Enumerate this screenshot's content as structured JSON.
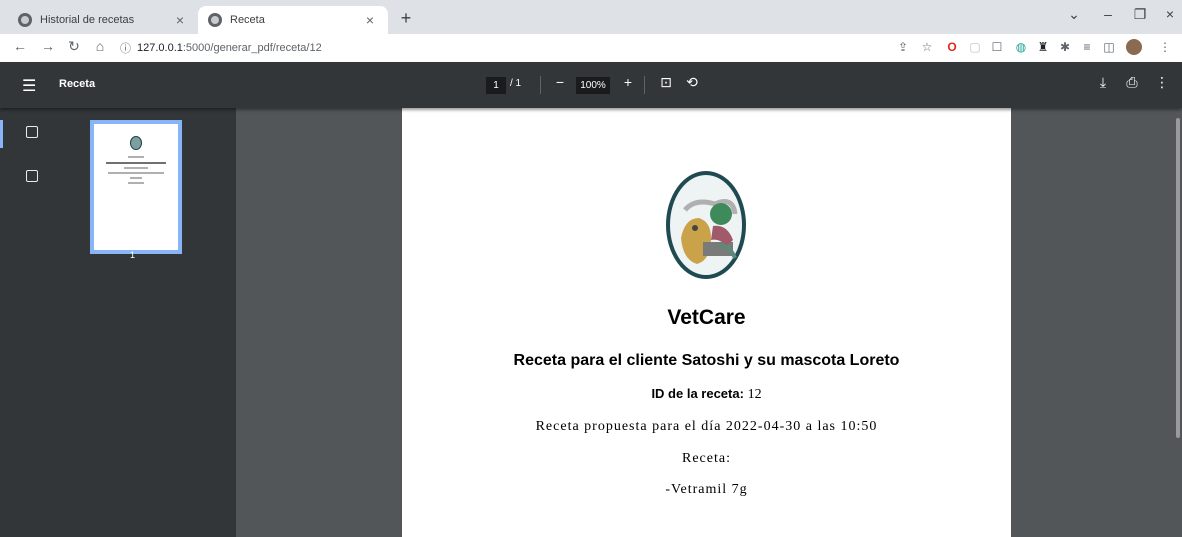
{
  "browser": {
    "tabs": [
      {
        "title": "Historial de recetas",
        "close": "×"
      },
      {
        "title": "Receta",
        "close": "×"
      }
    ],
    "new_tab": "+",
    "url": {
      "host": "127.0.0.1",
      "path": ":5000/generar_pdf/receta/12"
    }
  },
  "pdf_viewer": {
    "title": "Receta",
    "current_page": "1",
    "total_pages": "/ 1",
    "zoom": "100%",
    "thumbnail_page": "1"
  },
  "document": {
    "brand": "VetCare",
    "subtitle": "Receta para el cliente Satoshi y su mascota Loreto",
    "id_label": "ID de la receta:",
    "id_value": "12",
    "date_line": "Receta propuesta para el día 2022-04-30 a las 10:50",
    "prescription_label": "Receta:",
    "prescription_item": "-Vetramil 7g"
  },
  "colors": {
    "toolbar": "#323639",
    "viewer_bg": "#525659",
    "accent": "#8ab4f8"
  }
}
